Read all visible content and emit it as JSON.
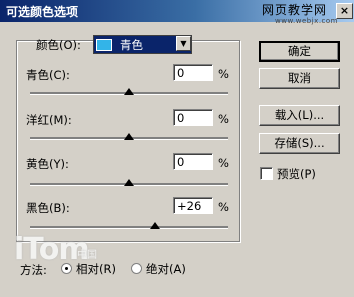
{
  "window": {
    "title": "可选颜色选项",
    "watermark": "网页教学网",
    "watermark_url": "www.webjx.com"
  },
  "colors_group": {
    "color_label": "颜色(O):",
    "color_value": "青色",
    "channels": [
      {
        "label": "青色(C):",
        "value": "0",
        "unit": "%",
        "slider": 0.5
      },
      {
        "label": "洋红(M):",
        "value": "0",
        "unit": "%",
        "slider": 0.5
      },
      {
        "label": "黄色(Y):",
        "value": "0",
        "unit": "%",
        "slider": 0.5
      },
      {
        "label": "黑色(B):",
        "value": "+26",
        "unit": "%",
        "slider": 0.63
      }
    ]
  },
  "buttons": {
    "ok": "确定",
    "cancel": "取消",
    "load": "载入(L)...",
    "save": "存储(S)..."
  },
  "preview": {
    "label": "预览(P)",
    "checked": false
  },
  "method": {
    "label": "方法:",
    "options": [
      "相对(R)",
      "绝对(A)"
    ],
    "selected": 0
  },
  "logo": {
    "main": "iTom",
    "sub": "中国"
  }
}
